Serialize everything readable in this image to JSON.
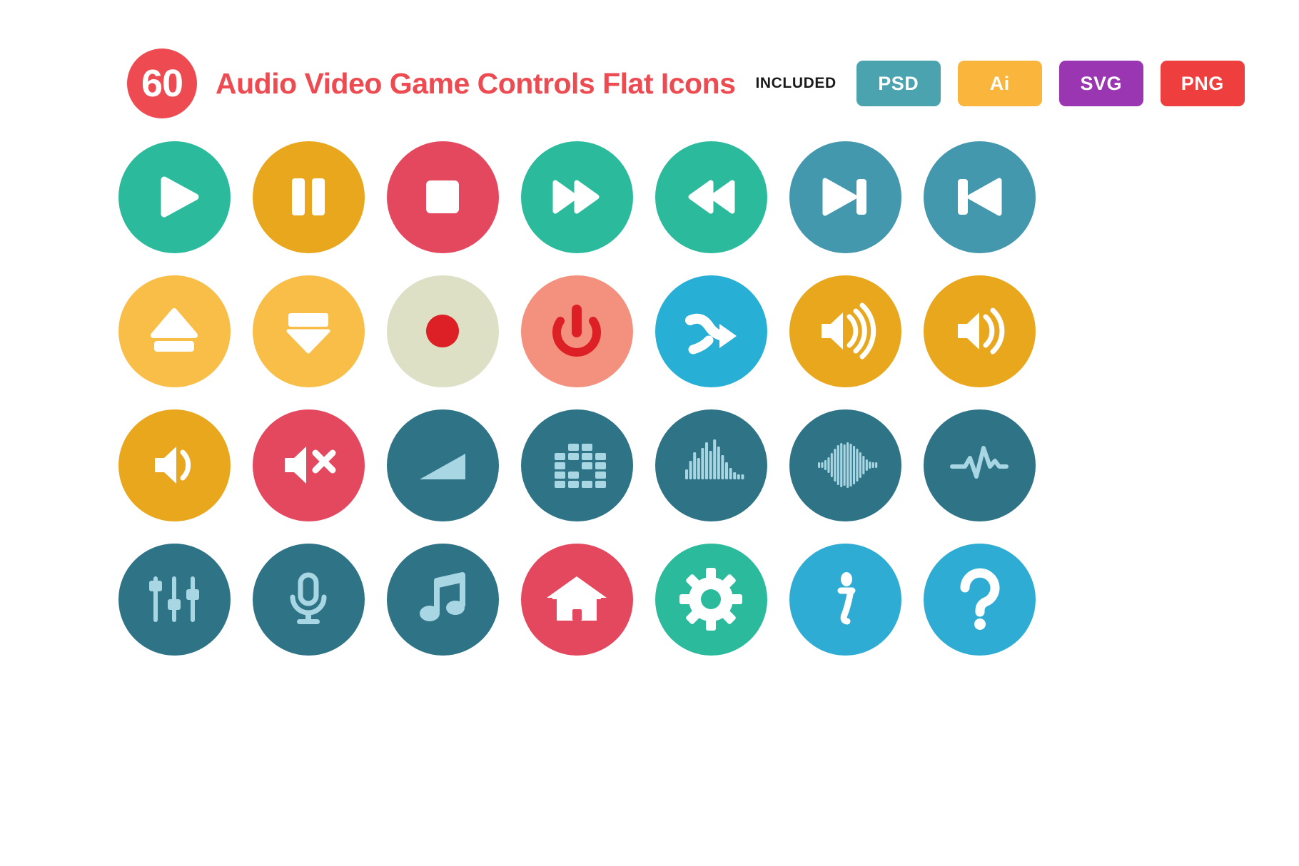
{
  "header": {
    "count": "60",
    "title": "Audio Video Game Controls Flat Icons",
    "included_label": "INCLUDED",
    "badges": [
      {
        "label": "PSD",
        "color": "#4BA3B0"
      },
      {
        "label": "Ai",
        "color": "#F9B53C"
      },
      {
        "label": "SVG",
        "color": "#9B36B2"
      },
      {
        "label": "PNG",
        "color": "#EE3E3E"
      }
    ],
    "count_badge_color": "#ED4B51",
    "title_color": "#ED4B51"
  },
  "palette": {
    "teal_green": "#2BBB9C",
    "golden": "#E8A71C",
    "light_yellow": "#F9BE48",
    "crimson": "#E4485F",
    "blue_steel": "#4398AE",
    "sage": "#DDE0C4",
    "red_dot": "#DD2026",
    "salmon": "#F4917E",
    "cyan": "#28AFD6",
    "dark_teal": "#2E7386",
    "pale_blue": "#A9D6E3",
    "sky": "#2FACD4",
    "white": "#FFFFFF"
  },
  "grid": {
    "columns": 7,
    "rows": 4,
    "icons": [
      {
        "name": "play-icon",
        "label": "Play",
        "bg": "#2BBB9C",
        "fg": "#FFFFFF"
      },
      {
        "name": "pause-icon",
        "label": "Pause",
        "bg": "#E8A71C",
        "fg": "#FFFFFF"
      },
      {
        "name": "stop-icon",
        "label": "Stop",
        "bg": "#E4485F",
        "fg": "#FFFFFF"
      },
      {
        "name": "fast-forward-icon",
        "label": "Fast Forward",
        "bg": "#2BBB9C",
        "fg": "#FFFFFF"
      },
      {
        "name": "rewind-icon",
        "label": "Rewind",
        "bg": "#2BBB9C",
        "fg": "#FFFFFF"
      },
      {
        "name": "next-track-icon",
        "label": "Next Track",
        "bg": "#4398AE",
        "fg": "#FFFFFF"
      },
      {
        "name": "previous-track-icon",
        "label": "Previous Track",
        "bg": "#4398AE",
        "fg": "#FFFFFF"
      },
      {
        "name": "eject-icon",
        "label": "Eject",
        "bg": "#F9BE48",
        "fg": "#FFFFFF"
      },
      {
        "name": "download-icon",
        "label": "Download",
        "bg": "#F9BE48",
        "fg": "#FFFFFF"
      },
      {
        "name": "record-icon",
        "label": "Record",
        "bg": "#DDE0C4",
        "fg": "#DD2026"
      },
      {
        "name": "power-icon",
        "label": "Power",
        "bg": "#F4917E",
        "fg": "#DD2026"
      },
      {
        "name": "shuffle-icon",
        "label": "Shuffle",
        "bg": "#28AFD6",
        "fg": "#FFFFFF"
      },
      {
        "name": "volume-high-icon",
        "label": "Volume High",
        "bg": "#E8A71C",
        "fg": "#FFFFFF"
      },
      {
        "name": "volume-medium-icon",
        "label": "Volume Medium",
        "bg": "#E8A71C",
        "fg": "#FFFFFF"
      },
      {
        "name": "volume-low-icon",
        "label": "Volume Low",
        "bg": "#E8A71C",
        "fg": "#FFFFFF"
      },
      {
        "name": "volume-mute-icon",
        "label": "Volume Mute",
        "bg": "#E4485F",
        "fg": "#FFFFFF"
      },
      {
        "name": "fade-in-icon",
        "label": "Fade In",
        "bg": "#2E7386",
        "fg": "#A9D6E3"
      },
      {
        "name": "equalizer-icon",
        "label": "Equalizer",
        "bg": "#2E7386",
        "fg": "#A9D6E3"
      },
      {
        "name": "audio-levels-icon",
        "label": "Audio Levels",
        "bg": "#2E7386",
        "fg": "#A9D6E3"
      },
      {
        "name": "sound-wave-icon",
        "label": "Sound Wave",
        "bg": "#2E7386",
        "fg": "#A9D6E3"
      },
      {
        "name": "pulse-wave-icon",
        "label": "Pulse Wave",
        "bg": "#2E7386",
        "fg": "#A9D6E3"
      },
      {
        "name": "mixer-sliders-icon",
        "label": "Mixer Sliders",
        "bg": "#2E7386",
        "fg": "#A9D6E3"
      },
      {
        "name": "microphone-icon",
        "label": "Microphone",
        "bg": "#2E7386",
        "fg": "#A9D6E3"
      },
      {
        "name": "music-note-icon",
        "label": "Music Note",
        "bg": "#2E7386",
        "fg": "#A9D6E3"
      },
      {
        "name": "home-icon",
        "label": "Home",
        "bg": "#E4485F",
        "fg": "#FFFFFF"
      },
      {
        "name": "settings-gear-icon",
        "label": "Settings",
        "bg": "#2BBB9C",
        "fg": "#FFFFFF"
      },
      {
        "name": "info-icon",
        "label": "Information",
        "bg": "#2FACD4",
        "fg": "#FFFFFF"
      },
      {
        "name": "help-icon",
        "label": "Help",
        "bg": "#2FACD4",
        "fg": "#FFFFFF"
      }
    ]
  }
}
